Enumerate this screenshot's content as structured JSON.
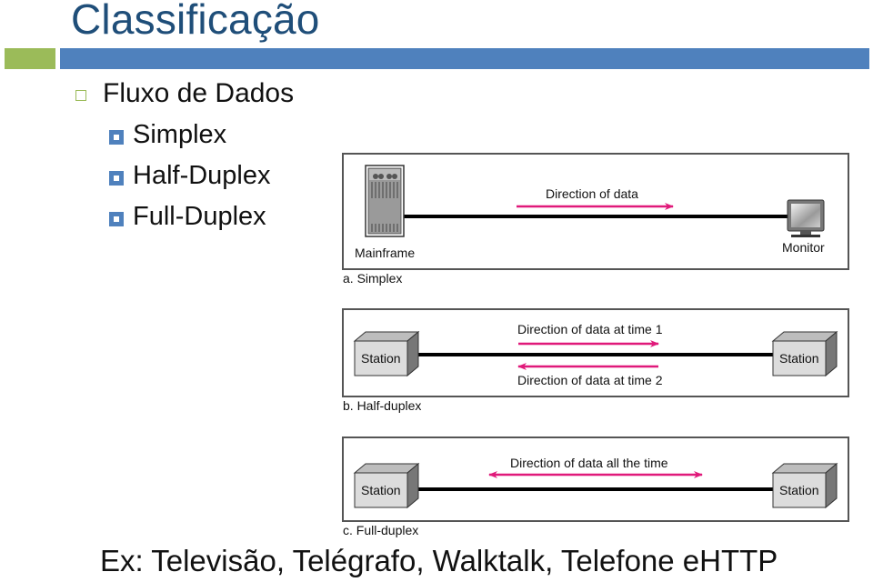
{
  "slide": {
    "title": "Classificação",
    "bullet": "Fluxo de Dados",
    "sub_bullets": [
      "Simplex",
      "Half-Duplex",
      "Full-Duplex"
    ],
    "footer": "Ex: Televisão, Telégrafo, Walktalk, Telefone eHTTP"
  },
  "colors": {
    "title": "#1f4e79",
    "accent_green": "#9bbb59",
    "accent_blue": "#4f81bd",
    "arrow": "#e0197a"
  },
  "figure": {
    "simplex": {
      "left_device": "Mainframe",
      "right_device": "Monitor",
      "arrow_label": "Direction of data",
      "caption": "a. Simplex"
    },
    "half_duplex": {
      "left_device": "Station",
      "right_device": "Station",
      "arrow_label_top": "Direction of data at time 1",
      "arrow_label_bottom": "Direction of data at time 2",
      "caption": "b. Half-duplex"
    },
    "full_duplex": {
      "left_device": "Station",
      "right_device": "Station",
      "arrow_label": "Direction of data all the time",
      "caption": "c. Full-duplex"
    }
  }
}
